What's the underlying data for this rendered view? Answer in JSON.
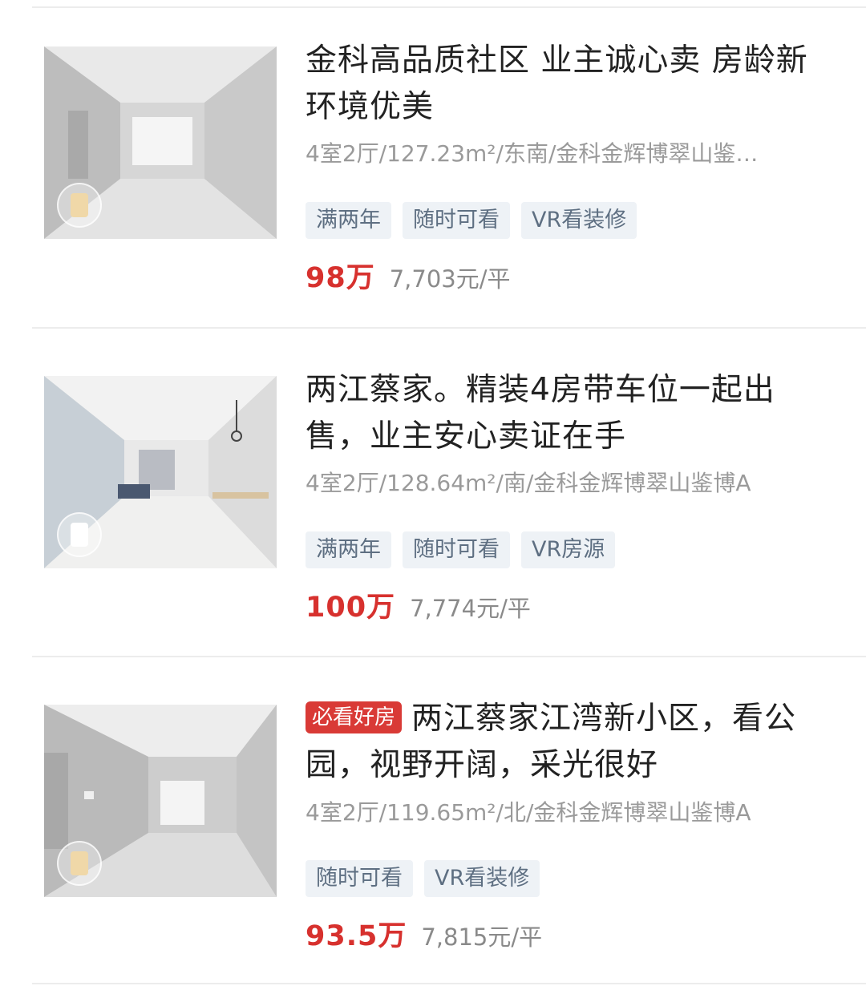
{
  "listings": [
    {
      "title": "金科高品质社区 业主诚心卖 房龄新 环境优美",
      "hot_tag": "",
      "specs": "4室2厅/127.23m²/东南/金科金辉博翠山鉴…",
      "tags": [
        "满两年",
        "随时可看",
        "VR看装修"
      ],
      "price": "98万",
      "unit_price": "7,703元/平"
    },
    {
      "title": "两江蔡家。精装4房带车位一起出售，业主安心卖证在手",
      "hot_tag": "",
      "specs": "4室2厅/128.64m²/南/金科金辉博翠山鉴博A",
      "tags": [
        "满两年",
        "随时可看",
        "VR房源"
      ],
      "price": "100万",
      "unit_price": "7,774元/平"
    },
    {
      "title": "两江蔡家江湾新小区，看公园，视野开阔，采光很好",
      "hot_tag": "必看好房",
      "specs": "4室2厅/119.65m²/北/金科金辉博翠山鉴博A",
      "tags": [
        "随时可看",
        "VR看装修"
      ],
      "price": "93.5万",
      "unit_price": "7,815元/平"
    }
  ],
  "colors": {
    "price": "#d7312e",
    "hot_tag": "#d93a36",
    "tag_bg": "#eef2f6",
    "tag_text": "#5e6f82"
  },
  "icons": {
    "thumbnail_badge": "vr-badge-icon"
  }
}
